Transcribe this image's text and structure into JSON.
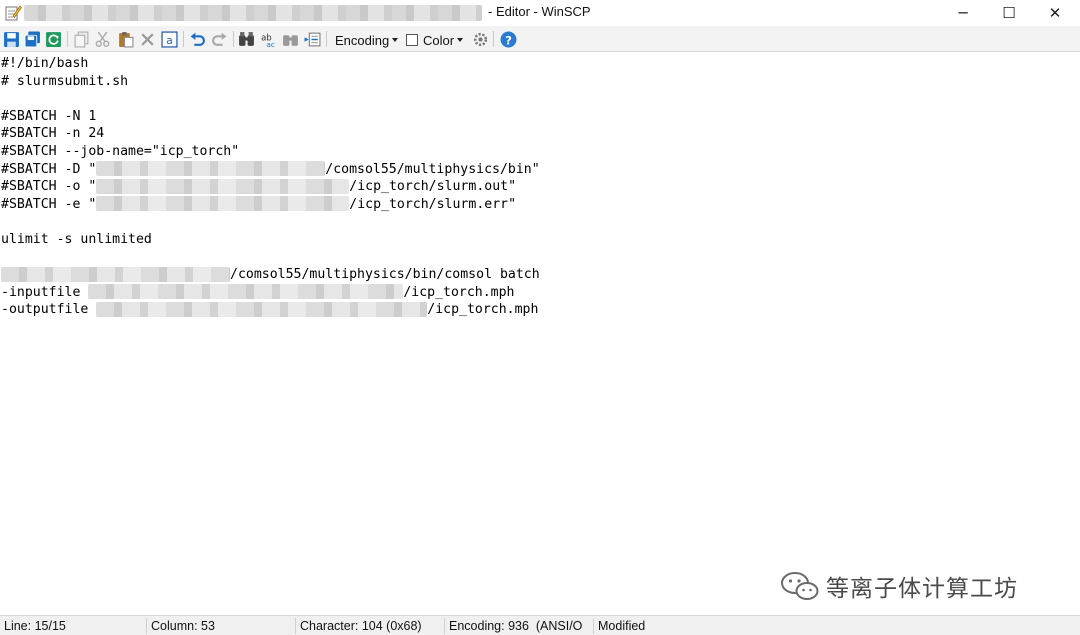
{
  "window": {
    "title_suffix": "- Editor - WinSCP",
    "controls": {
      "minimize": "─",
      "maximize": "☐",
      "close": "✕"
    }
  },
  "toolbar": {
    "icons": [
      "save-icon",
      "save-all-icon",
      "reload-icon",
      "copy-icon",
      "cut-icon",
      "paste-icon",
      "delete-icon",
      "select-all-icon",
      "undo-icon",
      "redo-icon",
      "find-icon",
      "replace-icon",
      "find-next-icon",
      "goto-line-icon",
      "preferences-icon",
      "help-icon"
    ],
    "encoding_label": "Encoding",
    "color_label": "Color"
  },
  "editor": {
    "lines": [
      {
        "pre": "#!/bin/bash",
        "post": ""
      },
      {
        "pre": "# slurmsubmit.sh",
        "post": ""
      },
      {
        "pre": "",
        "post": ""
      },
      {
        "pre": "#SBATCH -N 1",
        "post": ""
      },
      {
        "pre": "#SBATCH -n 24",
        "post": ""
      },
      {
        "pre": "#SBATCH --job-name=\"icp_torch\"",
        "post": ""
      },
      {
        "pre": "#SBATCH -D \"",
        "post": "/comsol55/multiphysics/bin\""
      },
      {
        "pre": "#SBATCH -o \"",
        "post": "/icp_torch/slurm.out\""
      },
      {
        "pre": "#SBATCH -e \"",
        "post": "/icp_torch/slurm.err\""
      },
      {
        "pre": "",
        "post": ""
      },
      {
        "pre": "ulimit -s unlimited",
        "post": ""
      },
      {
        "pre": "",
        "post": ""
      },
      {
        "pre": "",
        "post": "/comsol55/multiphysics/bin/comsol batch"
      },
      {
        "pre": "-inputfile ",
        "post": "/icp_torch.mph"
      },
      {
        "pre": "-outputfile ",
        "post": "/icp_torch.mph"
      }
    ]
  },
  "watermark": {
    "text": "等离子体计算工坊"
  },
  "statusbar": {
    "line": "Line: 15/15",
    "column": "Column: 53",
    "character": "Character: 104 (0x68)",
    "encoding": "Encoding: 936  (ANSI/O",
    "modified": "Modified"
  },
  "colors": {
    "accent_blue": "#1e6fc2",
    "help_blue": "#2a7ad1"
  }
}
